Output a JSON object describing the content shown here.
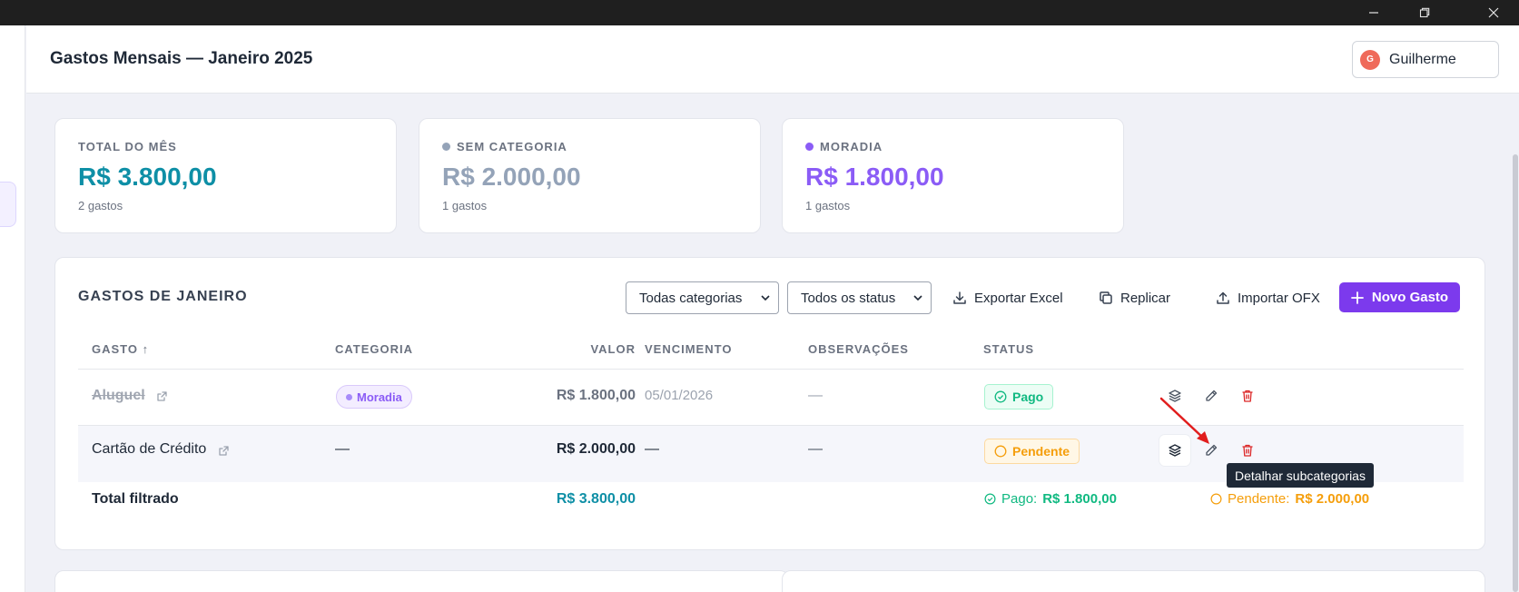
{
  "window": {
    "controls": [
      {
        "name": "minimize",
        "icon": "minimize-icon"
      },
      {
        "name": "restore",
        "icon": "restore-icon"
      },
      {
        "name": "close",
        "icon": "close-icon"
      }
    ]
  },
  "header": {
    "title": "Gastos Mensais — Janeiro 2025",
    "user": {
      "initial": "G",
      "name": "Guilherme",
      "avatar_color": "#ef6a5a"
    }
  },
  "stats": [
    {
      "label": "TOTAL DO MÊS",
      "value": "R$ 3.800,00",
      "count": "2 gastos",
      "color": "#0e8fa6",
      "dot": null
    },
    {
      "label": "SEM CATEGORIA",
      "value": "R$ 2.000,00",
      "count": "1 gastos",
      "color": "#94a3b8",
      "dot": "#94a3b8"
    },
    {
      "label": "MORADIA",
      "value": "R$ 1.800,00",
      "count": "1 gastos",
      "color": "#8b5cf6",
      "dot": "#8b5cf6"
    }
  ],
  "expenses": {
    "title": "GASTOS DE JANEIRO",
    "filters": {
      "category": {
        "selected": "Todas categorias"
      },
      "status": {
        "selected": "Todos os status"
      }
    },
    "actions": {
      "export": "Exportar Excel",
      "replicate": "Replicar",
      "import": "Importar OFX",
      "new": "Novo Gasto"
    },
    "columns": {
      "name": "GASTO ↑",
      "category": "CATEGORIA",
      "value": "VALOR",
      "due": "VENCIMENTO",
      "notes": "OBSERVAÇÕES",
      "status": "STATUS"
    },
    "rows": [
      {
        "name": "Aluguel",
        "category": "Moradia",
        "value": "R$ 1.800,00",
        "due": "05/01/2026",
        "notes": "—",
        "status": "Pago"
      },
      {
        "name": "Cartão de Crédito",
        "category": "—",
        "value": "R$ 2.000,00",
        "due": "—",
        "notes": "—",
        "status": "Pendente"
      }
    ],
    "total": {
      "label": "Total filtrado",
      "value": "R$ 3.800,00",
      "paid_label": "Pago:",
      "paid_value": "R$ 1.800,00",
      "pending_label": "Pendente:",
      "pending_value": "R$ 2.000,00"
    },
    "tooltip": "Detalhar subcategorias"
  },
  "colors": {
    "accent": "#7c3aed",
    "teal": "#0e8fa6",
    "paid": "#10b981",
    "pending": "#f59e0b",
    "danger": "#dc2626"
  }
}
